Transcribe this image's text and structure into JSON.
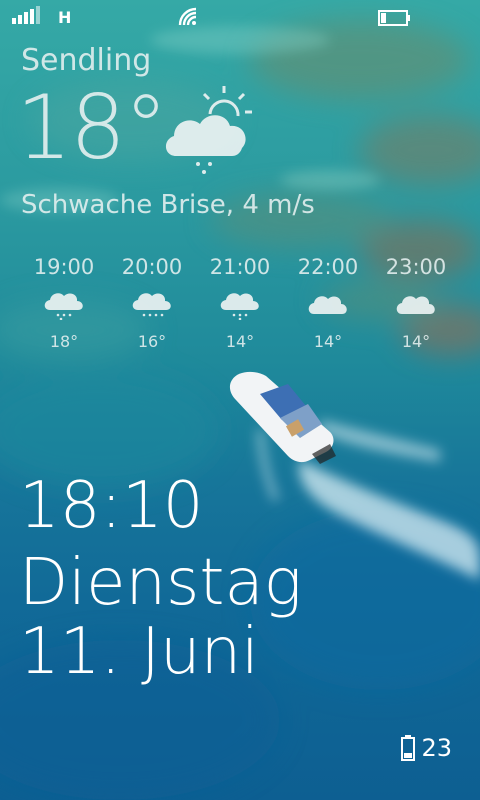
{
  "status_bar": {
    "network_type": "H",
    "signal_bars": 4,
    "battery_level": 0.2
  },
  "weather": {
    "location": "Sendling",
    "current_temp": "18°",
    "wind": "Schwache Brise, 4 m/s",
    "current_icon": "partly-cloudy-rain-icon",
    "hourly": [
      {
        "time": "19:00",
        "temp": "18°",
        "icon": "cloud-rain-icon"
      },
      {
        "time": "20:00",
        "temp": "16°",
        "icon": "cloud-rain-icon"
      },
      {
        "time": "21:00",
        "temp": "14°",
        "icon": "cloud-rain-icon"
      },
      {
        "time": "22:00",
        "temp": "14°",
        "icon": "cloud-icon"
      },
      {
        "time": "23:00",
        "temp": "14°",
        "icon": "cloud-icon"
      }
    ]
  },
  "lockscreen": {
    "time": "18:10",
    "day": "Dienstag",
    "date": "11. Juni"
  },
  "notifications": {
    "battery_count": "23"
  },
  "colors": {
    "text": "#ffffff",
    "weather_text": "#e6f0f0"
  }
}
